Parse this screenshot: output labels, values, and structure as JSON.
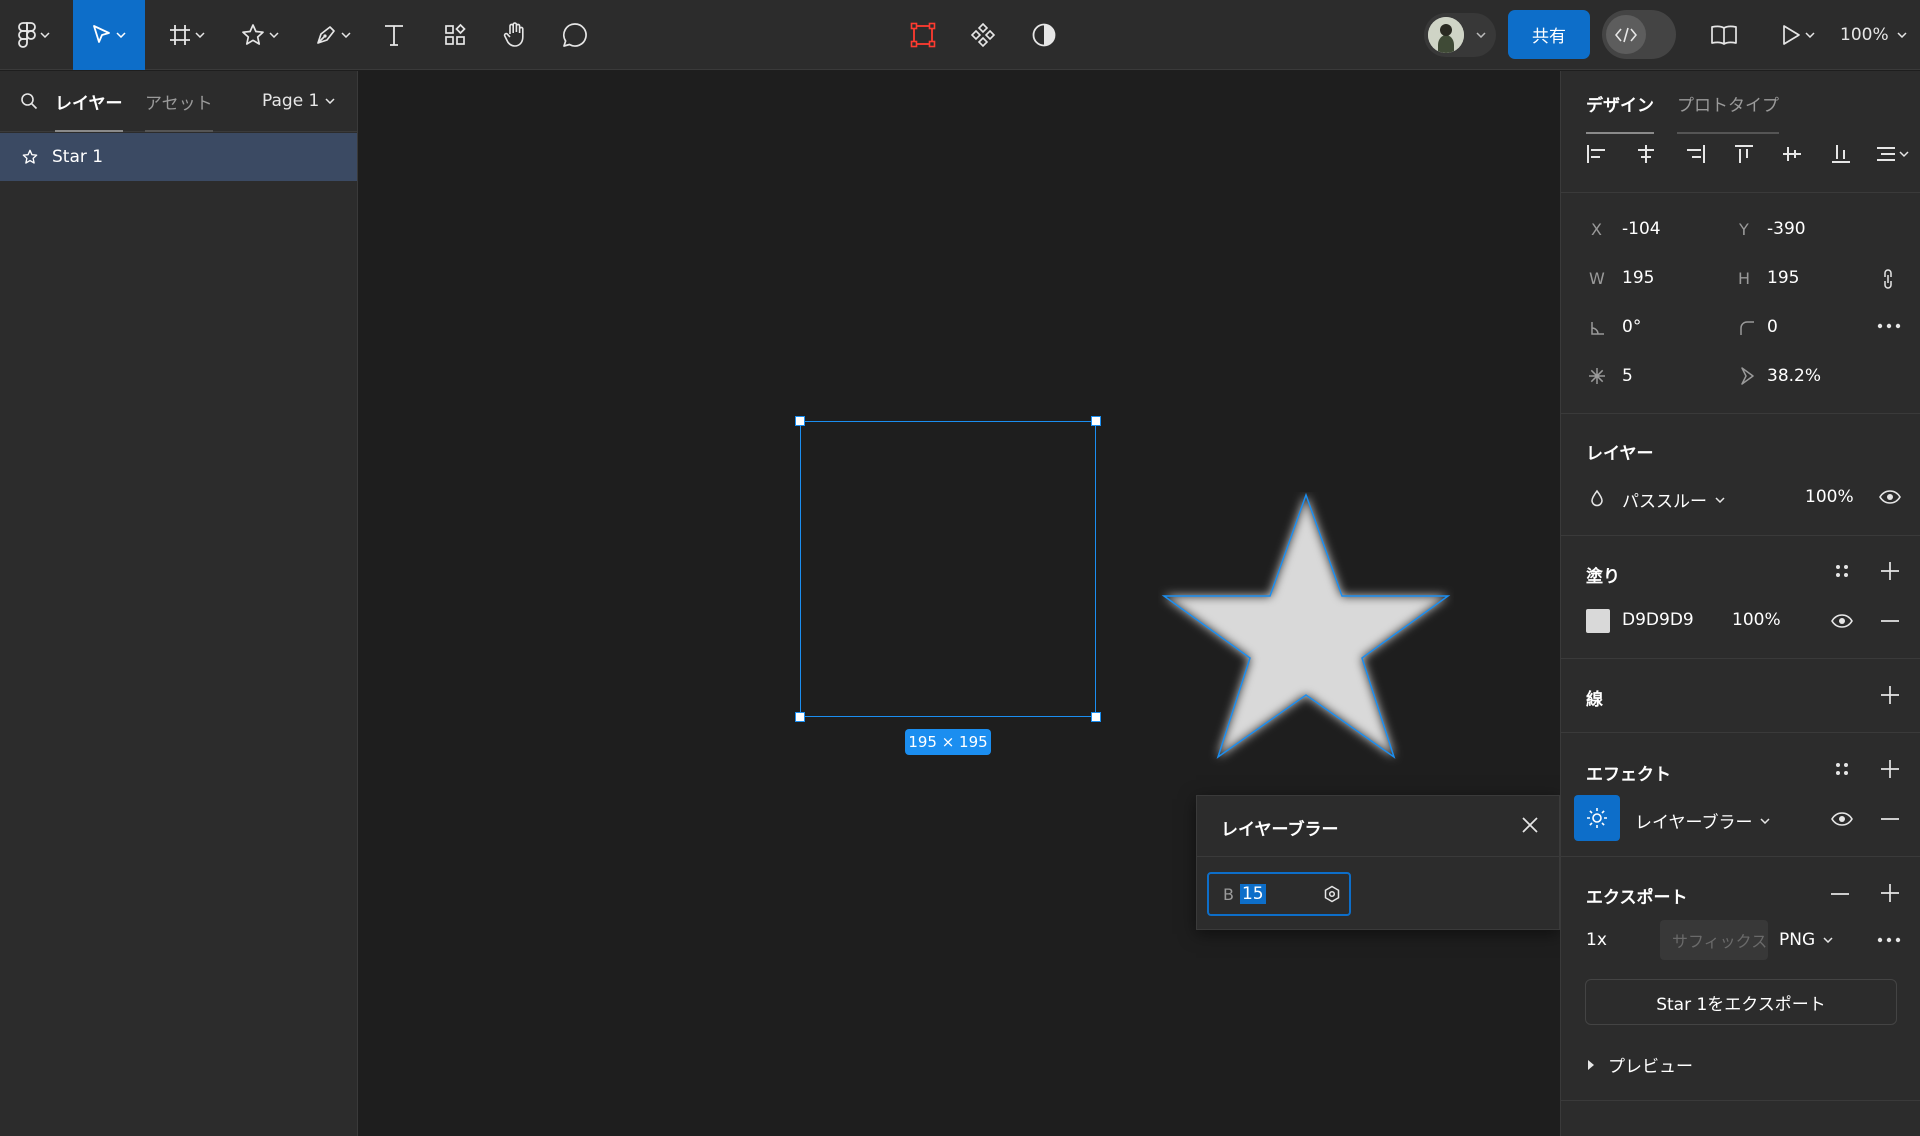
{
  "toolbar": {
    "share_label": "共有",
    "zoom": "100%"
  },
  "left_panel": {
    "tabs": [
      {
        "label": "レイヤー",
        "active": true
      },
      {
        "label": "アセット",
        "active": false
      }
    ],
    "page": "Page 1",
    "layers": [
      {
        "name": "Star 1",
        "selected": true
      }
    ]
  },
  "canvas": {
    "selection_size": "195 × 195",
    "star_fill": "#d9d9d9"
  },
  "blur_popup": {
    "title": "レイヤーブラー",
    "prefix": "B",
    "value": "15"
  },
  "right_panel": {
    "tabs": [
      {
        "label": "デザイン",
        "active": true
      },
      {
        "label": "プロトタイプ",
        "active": false
      }
    ],
    "transform": {
      "x_label": "X",
      "x": "-104",
      "y_label": "Y",
      "y": "-390",
      "w_label": "W",
      "w": "195",
      "h_label": "H",
      "h": "195",
      "rotation": "0°",
      "radius": "0",
      "points": "5",
      "ratio": "38.2%"
    },
    "layer": {
      "title": "レイヤー",
      "blend_mode": "パススルー",
      "opacity": "100%"
    },
    "fill": {
      "title": "塗り",
      "hex": "D9D9D9",
      "opacity": "100%",
      "color": "#d9d9d9"
    },
    "stroke": {
      "title": "線"
    },
    "effects": {
      "title": "エフェクト",
      "items": [
        {
          "label": "レイヤーブラー"
        }
      ]
    },
    "export": {
      "title": "エクスポート",
      "scale": "1x",
      "suffix_placeholder": "サフィックス",
      "format": "PNG",
      "button_label": "Star 1をエクスポート",
      "preview_label": "プレビュー"
    }
  },
  "colors": {
    "accent": "#0d6ec9",
    "selection": "#1b8ef0",
    "panel_bg": "#2c2c2c",
    "canvas_bg": "#1e1e1e"
  }
}
